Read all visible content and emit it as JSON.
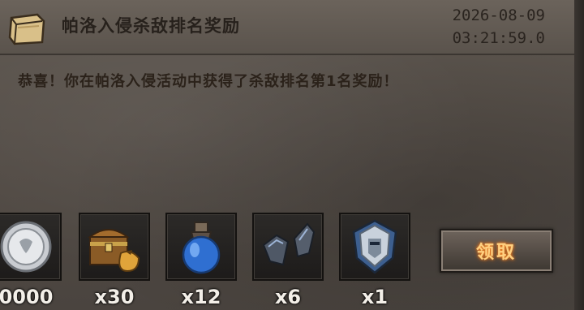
{
  "mail": {
    "title": "帕洛入侵杀敌排名奖励",
    "date": "2026-08-09",
    "time": "03:21:59.0",
    "message": "恭喜！你在帕洛入侵活动中获得了杀敌排名第1名奖励！"
  },
  "rewards": [
    {
      "icon": "silver-coin-icon",
      "qty": "0000"
    },
    {
      "icon": "treasure-chest-icon",
      "qty": "x30"
    },
    {
      "icon": "blue-potion-icon",
      "qty": "x12"
    },
    {
      "icon": "armor-shard-icon",
      "qty": "x6"
    },
    {
      "icon": "shield-helm-icon",
      "qty": "x1"
    }
  ],
  "actions": {
    "claim_label": "领取"
  }
}
